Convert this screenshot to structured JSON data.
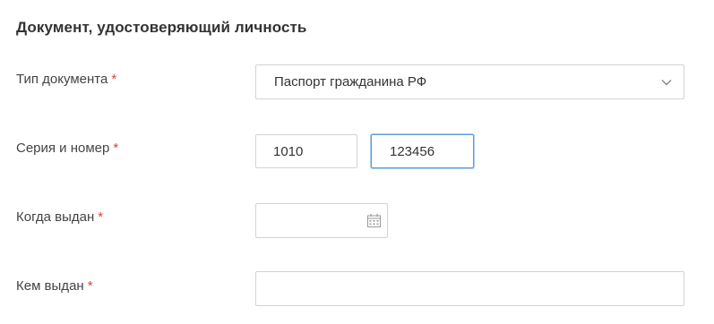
{
  "section": {
    "title": "Документ, удостоверяющий личность"
  },
  "fields": {
    "doc_type": {
      "label": "Тип документа",
      "required_mark": "*",
      "value": "Паспорт гражданина РФ"
    },
    "series_number": {
      "label": "Серия и номер",
      "required_mark": "*",
      "series_value": "1010",
      "number_value": "123456"
    },
    "issue_date": {
      "label": "Когда выдан",
      "required_mark": "*",
      "value": ""
    },
    "issued_by": {
      "label": "Кем выдан",
      "required_mark": "*",
      "value": ""
    }
  },
  "colors": {
    "required": "#e0422d",
    "focus_border": "#5b9dd9",
    "border": "#d3d3d3"
  },
  "icons": {
    "select_arrow": "chevron-down-icon",
    "date_picker": "calendar-icon"
  }
}
